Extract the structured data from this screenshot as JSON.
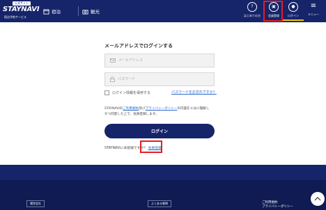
{
  "header": {
    "logo_badge": "公式サイト",
    "logo_brand": "STAYNAVI",
    "logo_sub": "宿泊予約サービス",
    "nav": [
      {
        "label": "宿泊",
        "icon": "calendar-icon"
      },
      {
        "label": "観光",
        "icon": "camera-icon"
      }
    ],
    "right": [
      {
        "label": "はじめての方",
        "icon": "question-icon",
        "glyph": "?"
      },
      {
        "label": "会員登録",
        "icon": "member-card-icon",
        "glyph": "▣"
      },
      {
        "label": "ログイン",
        "icon": "user-icon",
        "glyph": "●"
      },
      {
        "label": "メニュー",
        "icon": "menu-icon",
        "glyph": "≡"
      }
    ]
  },
  "login": {
    "title": "メールアドレスでログインする",
    "email_placeholder": "メールアドレス",
    "password_placeholder": "パスワード",
    "remember_label": "ログイン情報を保存する",
    "forgot_link": "パスワードをお忘れですか？",
    "terms_prefix": "STAYNAVIの",
    "terms_link1": "ご利用規約",
    "terms_mid": "及び",
    "terms_link2": "プライバシーポリシー",
    "terms_suffix": "の内容を十分に理解し",
    "terms_line2": "かつ同意した上で、会員登録します。",
    "login_button": "ログイン",
    "register_text": "STAYNAVIに未登録ですか？",
    "register_link": "会員登録"
  },
  "footer": {
    "btn1": "運営会社",
    "btn2": "よくある質問",
    "right_line1": "ご利用規約",
    "right_line2": "プライバシーポリシー"
  },
  "colors": {
    "header_bg": "#16246a",
    "link": "#2a67c9",
    "highlight": "#e81d1d",
    "active_underline": "#f0c400"
  }
}
